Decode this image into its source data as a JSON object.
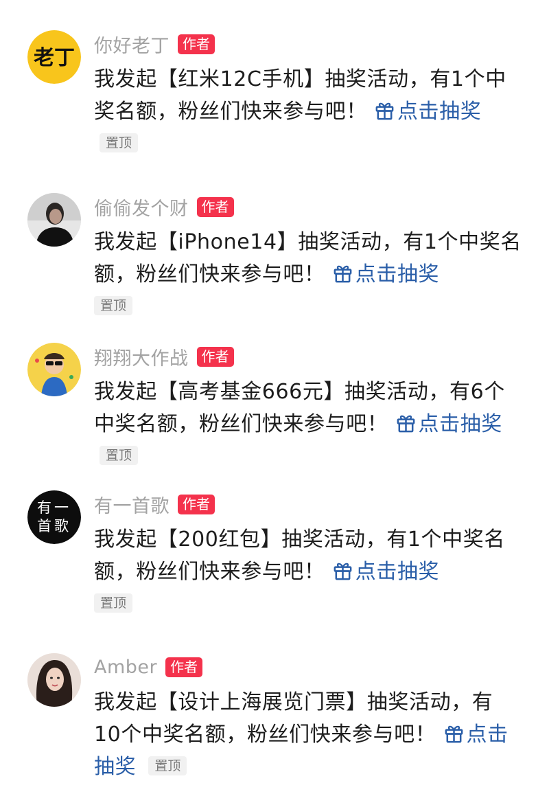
{
  "comments": [
    {
      "username": "你好老丁",
      "badge": "作者",
      "avatar_text": "老丁",
      "message": "我发起【红米12C手机】抽奖活动，有1个中奖名额，粉丝们快来参与吧！",
      "lottery_link": "点击抽奖",
      "pin_tag": "置顶"
    },
    {
      "username": "偷偷发个财",
      "badge": "作者",
      "avatar_text": "",
      "message": "我发起【iPhone14】抽奖活动，有1个中奖名额，粉丝们快来参与吧！",
      "lottery_link": "点击抽奖",
      "pin_tag": "置顶"
    },
    {
      "username": "翔翔大作战",
      "badge": "作者",
      "avatar_text": "",
      "message": "我发起【高考基金666元】抽奖活动，有6个中奖名额，粉丝们快来参与吧！",
      "lottery_link": "点击抽奖",
      "pin_tag": "置顶"
    },
    {
      "username": "有一首歌",
      "badge": "作者",
      "avatar_text": "有一首歌",
      "message": "我发起【200红包】抽奖活动，有1个中奖名额，粉丝们快来参与吧！",
      "lottery_link": "点击抽奖",
      "pin_tag": "置顶"
    },
    {
      "username": "Amber",
      "badge": "作者",
      "avatar_text": "",
      "message": "我发起【设计上海展览门票】抽奖活动，有10个中奖名额，粉丝们快来参与吧！",
      "lottery_link": "点击抽奖",
      "pin_tag": "置顶"
    }
  ],
  "colors": {
    "badge_bg": "#f4324c",
    "link": "#2a5ea8",
    "username": "#a3a3a3",
    "avatar_yellow": "#f8c51c"
  },
  "icons": {
    "lottery_icon": "gift-icon"
  }
}
